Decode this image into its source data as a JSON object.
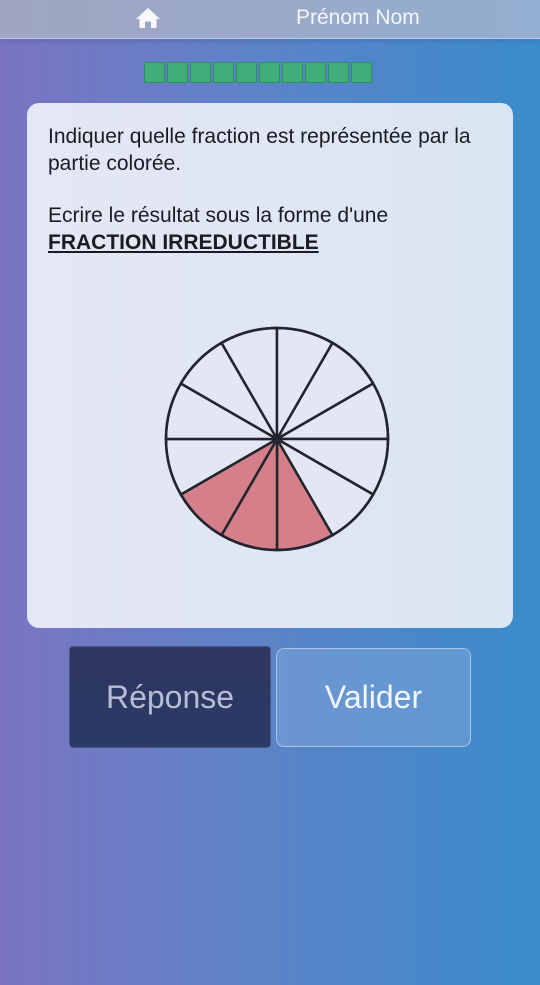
{
  "header": {
    "home_icon": "home-icon",
    "user_name": "Prénom Nom"
  },
  "progress": {
    "total_steps": 10,
    "completed_steps": 10,
    "color": "#41ae7a"
  },
  "question": {
    "line1": "Indiquer quelle fraction est représentée par la partie colorée.",
    "line2": "Ecrire le résultat sous la forme d'une",
    "emphasis": "FRACTION IRREDUCTIBLE"
  },
  "pie": {
    "total_slices": 12,
    "colored_slices": 3,
    "fill_color": "#d47f89",
    "empty_color": "#e3e6f3"
  },
  "buttons": {
    "reponse_label": "Réponse",
    "valider_label": "Valider"
  }
}
